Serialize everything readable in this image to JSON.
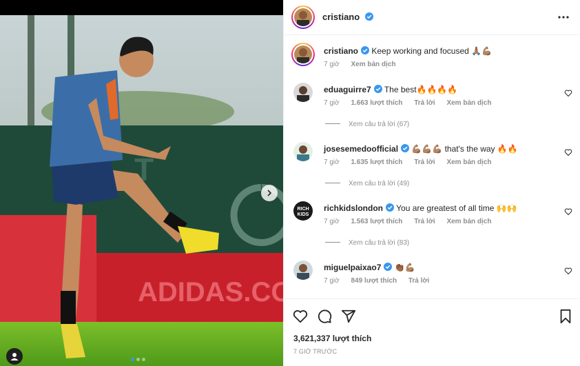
{
  "post": {
    "author": "cristiano",
    "caption": "Keep working and focused",
    "caption_emoji": "🙏🏽💪🏽",
    "caption_time": "7 giờ",
    "see_translation": "Xem bản dịch",
    "likes": "3,621,337 lượt thích",
    "posted_ago": "7 GIỜ TRƯỚC",
    "billboard_text": "ADIDAS.COM"
  },
  "comments": [
    {
      "user": "eduaguirre7",
      "text": "The best",
      "emoji": "🔥🔥🔥🔥",
      "time": "7 giờ",
      "likes": "1.663 lượt thích",
      "reply": "Trả lời",
      "translate": "Xem bản dịch",
      "view_replies": "Xem câu trả lời (67)"
    },
    {
      "user": "josesemedoofficial",
      "text": "that's the way",
      "emoji_before": "💪🏽💪🏽💪🏽",
      "emoji": "🔥🔥",
      "time": "7 giờ",
      "likes": "1.635 lượt thích",
      "reply": "Trả lời",
      "translate": "Xem bản dịch",
      "view_replies": "Xem câu trả lời (49)"
    },
    {
      "user": "richkidslondon",
      "text": "You are greatest of all time",
      "emoji": "🙌🙌",
      "time": "7 giờ",
      "likes": "1.563 lượt thích",
      "reply": "Trả lời",
      "translate": "Xem bản dịch",
      "view_replies": "Xem câu trả lời (83)"
    },
    {
      "user": "miguelpaixao7",
      "text": "",
      "emoji": "👏🏾💪🏽",
      "time": "7 giờ",
      "likes": "849 lượt thích",
      "reply": "Trả lời"
    }
  ],
  "icons": {
    "header_more": "more-horizontal-icon",
    "verified": "verified-badge-icon",
    "like": "heart-icon",
    "comment": "comment-icon",
    "share": "share-icon",
    "save": "bookmark-icon",
    "next": "chevron-right-icon",
    "tagged": "user-tag-icon"
  },
  "colors": {
    "verified": "#3897f0",
    "text": "#262626",
    "muted": "#8e8e8e",
    "divider": "#efefef"
  }
}
